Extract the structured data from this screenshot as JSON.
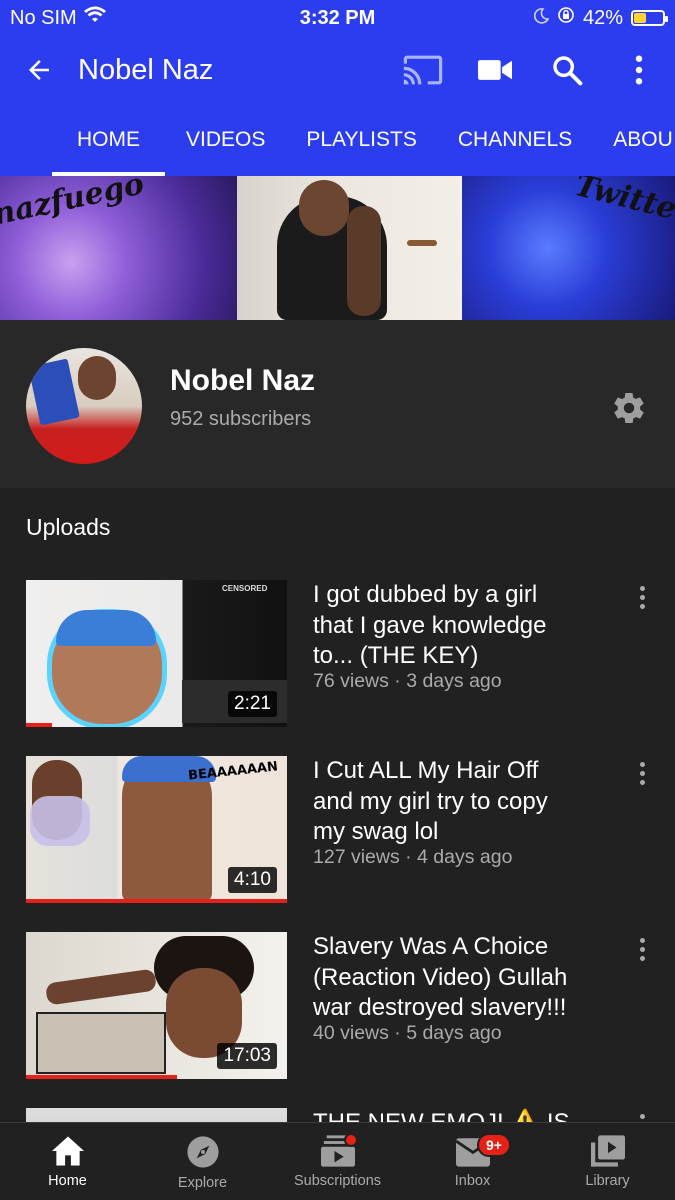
{
  "status_bar": {
    "carrier": "No SIM",
    "time": "3:32 PM",
    "battery_percent": "42%",
    "battery_level": 0.42
  },
  "app_bar": {
    "title": "Nobel Naz",
    "icons": [
      "back-arrow-icon",
      "cast-icon",
      "video-camera-icon",
      "search-icon",
      "more-vert-icon"
    ]
  },
  "tabs": [
    {
      "label": "HOME",
      "active": true
    },
    {
      "label": "VIDEOS"
    },
    {
      "label": "PLAYLISTS"
    },
    {
      "label": "CHANNELS"
    },
    {
      "label": "ABOU"
    }
  ],
  "banner": {
    "left_text": "nazfuego",
    "right_text": "Twitte"
  },
  "channel": {
    "name": "Nobel Naz",
    "subscribers": "952 subscribers"
  },
  "section_title": "Uploads",
  "videos": [
    {
      "title_lines": [
        "I got dubbed by a girl",
        "that I gave knowledge",
        "to... (THE KEY)"
      ],
      "meta": "76 views · 3 days ago",
      "duration": "2:21",
      "thumb_text": "CENSORED",
      "watched_fraction": 0.1
    },
    {
      "title_lines": [
        "I Cut ALL My Hair Off",
        "and my girl try to copy",
        "my swag lol"
      ],
      "meta": "127 views · 4 days ago",
      "duration": "4:10",
      "thumb_text": "BEAAAAAAN",
      "watched_fraction": 1.0
    },
    {
      "title_lines": [
        "Slavery Was A Choice",
        "(Reaction Video) Gullah",
        "war destroyed slavery!!!"
      ],
      "meta": "40 views · 5 days ago",
      "duration": "17:03",
      "watched_fraction": 0.58
    },
    {
      "title_lines": [
        "THE NEW EMOJI ⚠️ IS"
      ]
    }
  ],
  "bottom_nav": [
    {
      "label": "Home",
      "icon": "home-icon",
      "active": true
    },
    {
      "label": "Explore",
      "icon": "compass-icon"
    },
    {
      "label": "Subscriptions",
      "icon": "subscriptions-icon"
    },
    {
      "label": "Inbox",
      "icon": "inbox-icon",
      "badge": "9+"
    },
    {
      "label": "Library",
      "icon": "library-icon"
    }
  ],
  "colors": {
    "brand_blue": "#2c3df0",
    "background": "#212121",
    "accent_red": "#e62117"
  }
}
